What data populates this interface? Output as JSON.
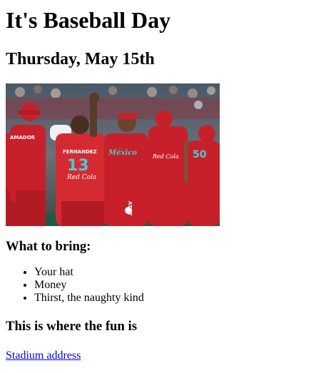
{
  "page": {
    "title": "It's Baseball Day",
    "date": "Thursday, May 15th",
    "photo_alt": "Baseball team celebrating",
    "bring_heading": "What to bring:",
    "bring_items": [
      "Your hat",
      "Money",
      "Thirst, the naughty kind"
    ],
    "fun_heading": "This is where the fun is",
    "link_label": "Stadium address"
  },
  "photo": {
    "jersey_text": [
      "Red Cola",
      "México",
      "AT&T",
      "Red Cola"
    ],
    "numbers": [
      "13",
      "50"
    ],
    "names": [
      "FERNANDEZ",
      "AMADOR"
    ]
  },
  "colors": {
    "jersey": "#c8202a",
    "link": "#0000ee"
  }
}
